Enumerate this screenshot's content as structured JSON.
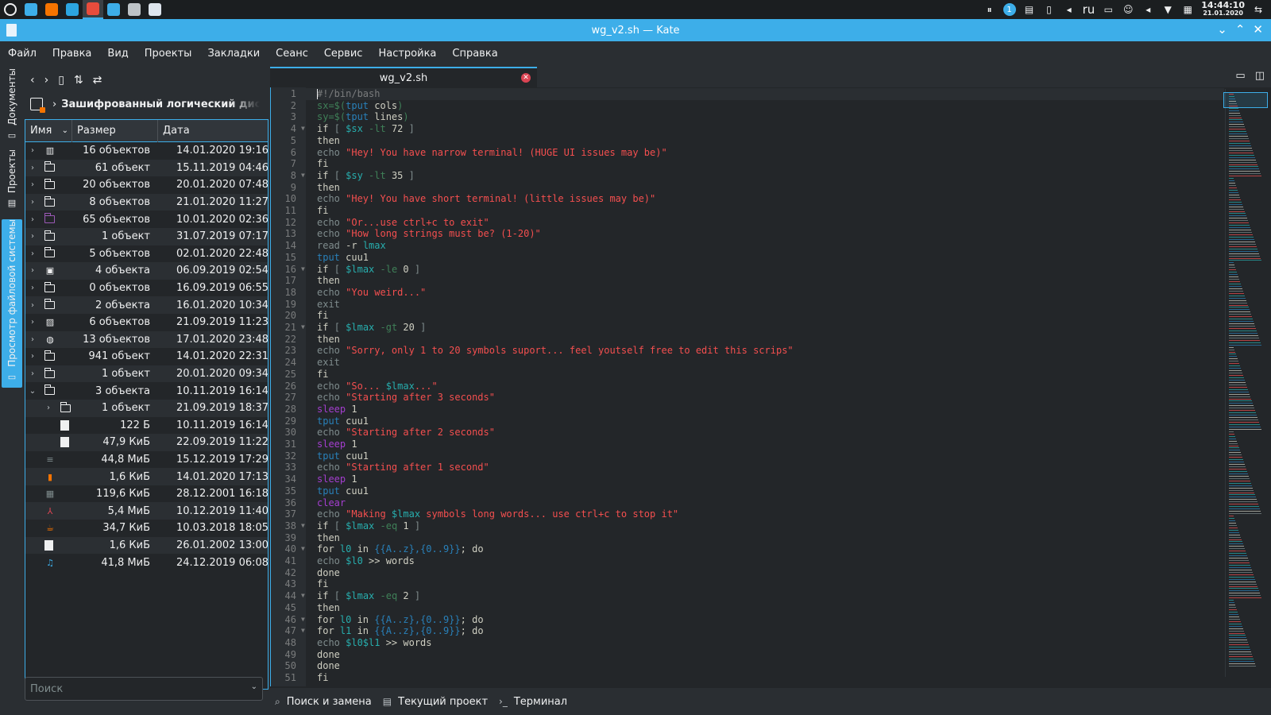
{
  "taskbar": {
    "apps": [
      {
        "name": "launcher-icon",
        "color": "#eff0f1"
      },
      {
        "name": "files-icon",
        "color": "#3daee9"
      },
      {
        "name": "firefox-icon",
        "color": "#f67400"
      },
      {
        "name": "telegram-icon",
        "color": "#2ca5e0"
      },
      {
        "name": "chrome-icon",
        "color": "#e74c3c"
      },
      {
        "name": "kdeconnect-icon",
        "color": "#3daee9"
      },
      {
        "name": "x-app-icon",
        "color": "#bdc3c7"
      },
      {
        "name": "kate-icon",
        "color": "#dfe6ee"
      }
    ],
    "tray": {
      "keyboard_layout": "ru",
      "clock_time": "14:44:10",
      "clock_date": "21.01.2020",
      "badge_count": "1"
    }
  },
  "window": {
    "title": "wg_v2.sh — Kate"
  },
  "menu": [
    "Файл",
    "Правка",
    "Вид",
    "Проекты",
    "Закладки",
    "Сеанс",
    "Сервис",
    "Настройка",
    "Справка"
  ],
  "sidetabs": {
    "documents": "Документы",
    "projects": "Проекты",
    "filesystem": "Просмотр файловой системы"
  },
  "filepanel": {
    "breadcrumb": "Зашифрованный логический диск",
    "columns": {
      "name": "Имя",
      "size": "Размер",
      "date": "Дата"
    },
    "rows": [
      {
        "size": "16 объектов",
        "date": "14.01.2020 19:16",
        "icon": "library",
        "depth": 0,
        "expander": "right"
      },
      {
        "size": "61 объект",
        "date": "15.11.2019 04:46",
        "icon": "folder",
        "depth": 0,
        "expander": "right"
      },
      {
        "size": "20 объектов",
        "date": "20.01.2020 07:48",
        "icon": "folder",
        "depth": 0,
        "expander": "right"
      },
      {
        "size": "8 объектов",
        "date": "21.01.2020 11:27",
        "icon": "folder",
        "depth": 0,
        "expander": "right"
      },
      {
        "size": "65 объектов",
        "date": "10.01.2020 02:36",
        "icon": "folder-purple",
        "depth": 0,
        "expander": "right"
      },
      {
        "size": "1 объект",
        "date": "31.07.2019 07:17",
        "icon": "folder",
        "depth": 0,
        "expander": "right"
      },
      {
        "size": "5 объектов",
        "date": "02.01.2020 22:48",
        "icon": "folder",
        "depth": 0,
        "expander": "right"
      },
      {
        "size": "4 объекта",
        "date": "06.09.2019 02:54",
        "icon": "documents",
        "depth": 0,
        "expander": "right"
      },
      {
        "size": "0 объектов",
        "date": "16.09.2019 06:55",
        "icon": "folder",
        "depth": 0,
        "expander": "right"
      },
      {
        "size": "2 объекта",
        "date": "16.01.2020 10:34",
        "icon": "folder",
        "depth": 0,
        "expander": "right"
      },
      {
        "size": "6 объектов",
        "date": "21.09.2019 11:23",
        "icon": "pictures",
        "depth": 0,
        "expander": "right"
      },
      {
        "size": "13 объектов",
        "date": "17.01.2020 23:48",
        "icon": "public",
        "depth": 0,
        "expander": "right"
      },
      {
        "size": "941 объект",
        "date": "14.01.2020 22:31",
        "icon": "folder",
        "depth": 0,
        "expander": "right"
      },
      {
        "size": "1 объект",
        "date": "20.01.2020 09:34",
        "icon": "folder",
        "depth": 0,
        "expander": "right"
      },
      {
        "size": "3 объекта",
        "date": "10.11.2019 16:14",
        "icon": "folder",
        "depth": 0,
        "expander": "down"
      },
      {
        "size": "1 объект",
        "date": "21.09.2019 18:37",
        "icon": "folder",
        "depth": 1,
        "expander": "right"
      },
      {
        "size": "122 Б",
        "date": "10.11.2019 16:14",
        "icon": "file",
        "depth": 1,
        "expander": "none"
      },
      {
        "size": "47,9 КиБ",
        "date": "22.09.2019 11:22",
        "icon": "file",
        "depth": 1,
        "expander": "none"
      },
      {
        "size": "44,8 МиБ",
        "date": "15.12.2019 17:29",
        "icon": "archive",
        "depth": 0,
        "expander": "none"
      },
      {
        "size": "1,6 КиБ",
        "date": "14.01.2020 17:13",
        "icon": "locked-file",
        "depth": 0,
        "expander": "none"
      },
      {
        "size": "119,6 КиБ",
        "date": "28.12.2001 16:18",
        "icon": "spreadsheet",
        "depth": 0,
        "expander": "none"
      },
      {
        "size": "5,4 МиБ",
        "date": "10.12.2019 11:40",
        "icon": "pdf",
        "depth": 0,
        "expander": "none"
      },
      {
        "size": "34,7 КиБ",
        "date": "10.03.2018 18:05",
        "icon": "java",
        "depth": 0,
        "expander": "none"
      },
      {
        "size": "1,6 КиБ",
        "date": "26.01.2002 13:00",
        "icon": "blank-file",
        "depth": 0,
        "expander": "none"
      },
      {
        "size": "41,8 МиБ",
        "date": "24.12.2019 06:08",
        "icon": "audio",
        "depth": 0,
        "expander": "none"
      }
    ],
    "search_placeholder": "Поиск"
  },
  "editor": {
    "tab_title": "wg_v2.sh",
    "lines": [
      [
        [
          "cm",
          "#!/bin/bash"
        ]
      ],
      [
        [
          "op",
          "sx=$("
        ],
        [
          "cmd",
          "tput"
        ],
        [
          "pl",
          " cols"
        ],
        [
          "op",
          ")"
        ]
      ],
      [
        [
          "op",
          "sy=$("
        ],
        [
          "cmd",
          "tput"
        ],
        [
          "pl",
          " lines"
        ],
        [
          "op",
          ")"
        ]
      ],
      [
        [
          "pl",
          "if "
        ],
        [
          "bi",
          "[ "
        ],
        [
          "var",
          "$sx"
        ],
        [
          "op",
          " -lt"
        ],
        [
          "pl",
          " 72 "
        ],
        [
          "bi",
          "]"
        ]
      ],
      [
        [
          "pl",
          "then"
        ]
      ],
      [
        [
          "bi",
          "echo "
        ],
        [
          "str",
          "\"Hey! You have narrow terminal! (HUGE UI issues may be)\""
        ]
      ],
      [
        [
          "pl",
          "fi"
        ]
      ],
      [
        [
          "pl",
          "if "
        ],
        [
          "bi",
          "[ "
        ],
        [
          "var",
          "$sy"
        ],
        [
          "op",
          " -lt"
        ],
        [
          "pl",
          " 35 "
        ],
        [
          "bi",
          "]"
        ]
      ],
      [
        [
          "pl",
          "then"
        ]
      ],
      [
        [
          "bi",
          "echo "
        ],
        [
          "str",
          "\"Hey! You have short terminal! (little issues may be)\""
        ]
      ],
      [
        [
          "pl",
          "fi"
        ]
      ],
      [
        [
          "bi",
          "echo "
        ],
        [
          "str",
          "\"Or...use ctrl+c to exit\""
        ]
      ],
      [
        [
          "bi",
          "echo "
        ],
        [
          "str",
          "\"How long strings must be? (1-20)\""
        ]
      ],
      [
        [
          "bi",
          "read "
        ],
        [
          "pl",
          "-r "
        ],
        [
          "var",
          "lmax"
        ]
      ],
      [
        [
          "cmd",
          "tput"
        ],
        [
          "pl",
          " cuu1"
        ]
      ],
      [
        [
          "pl",
          "if "
        ],
        [
          "bi",
          "[ "
        ],
        [
          "var",
          "$lmax"
        ],
        [
          "op",
          " -le"
        ],
        [
          "pl",
          " 0 "
        ],
        [
          "bi",
          "]"
        ]
      ],
      [
        [
          "pl",
          "then"
        ]
      ],
      [
        [
          "bi",
          "echo "
        ],
        [
          "str",
          "\"You weird...\""
        ]
      ],
      [
        [
          "bi",
          "exit"
        ]
      ],
      [
        [
          "pl",
          "fi"
        ]
      ],
      [
        [
          "pl",
          "if "
        ],
        [
          "bi",
          "[ "
        ],
        [
          "var",
          "$lmax"
        ],
        [
          "op",
          " -gt"
        ],
        [
          "pl",
          " 20 "
        ],
        [
          "bi",
          "]"
        ]
      ],
      [
        [
          "pl",
          "then"
        ]
      ],
      [
        [
          "bi",
          "echo "
        ],
        [
          "str",
          "\"Sorry, only 1 to 20 symbols suport... feel youtself free to edit this scrips\""
        ]
      ],
      [
        [
          "bi",
          "exit"
        ]
      ],
      [
        [
          "pl",
          "fi"
        ]
      ],
      [
        [
          "bi",
          "echo "
        ],
        [
          "str",
          "\"So... "
        ],
        [
          "var",
          "$lmax"
        ],
        [
          "str",
          "...\""
        ]
      ],
      [
        [
          "bi",
          "echo "
        ],
        [
          "str",
          "\"Starting after 3 seconds\""
        ]
      ],
      [
        [
          "purple",
          "sleep"
        ],
        [
          "pl",
          " 1"
        ]
      ],
      [
        [
          "cmd",
          "tput"
        ],
        [
          "pl",
          " cuu1"
        ]
      ],
      [
        [
          "bi",
          "echo "
        ],
        [
          "str",
          "\"Starting after 2 seconds\""
        ]
      ],
      [
        [
          "purple",
          "sleep"
        ],
        [
          "pl",
          " 1"
        ]
      ],
      [
        [
          "cmd",
          "tput"
        ],
        [
          "pl",
          " cuu1"
        ]
      ],
      [
        [
          "bi",
          "echo "
        ],
        [
          "str",
          "\"Starting after 1 second\""
        ]
      ],
      [
        [
          "purple",
          "sleep"
        ],
        [
          "pl",
          " 1"
        ]
      ],
      [
        [
          "cmd",
          "tput"
        ],
        [
          "pl",
          " cuu1"
        ]
      ],
      [
        [
          "purple",
          "clear"
        ]
      ],
      [
        [
          "bi",
          "echo "
        ],
        [
          "str",
          "\"Making "
        ],
        [
          "var",
          "$lmax"
        ],
        [
          "str",
          " symbols long words... use ctrl+c to stop it\""
        ]
      ],
      [
        [
          "pl",
          "if "
        ],
        [
          "bi",
          "[ "
        ],
        [
          "var",
          "$lmax"
        ],
        [
          "op",
          " -eq"
        ],
        [
          "pl",
          " 1 "
        ],
        [
          "bi",
          "]"
        ]
      ],
      [
        [
          "pl",
          "then"
        ]
      ],
      [
        [
          "pl",
          "for "
        ],
        [
          "var",
          "l0"
        ],
        [
          "pl",
          " in "
        ],
        [
          "cyan",
          "{{A..z},{0..9}}"
        ],
        [
          "pl",
          "; do"
        ]
      ],
      [
        [
          "bi",
          "echo "
        ],
        [
          "var",
          "$l0"
        ],
        [
          "pl",
          " >> words"
        ]
      ],
      [
        [
          "pl",
          "done"
        ]
      ],
      [
        [
          "pl",
          "fi"
        ]
      ],
      [
        [
          "pl",
          "if "
        ],
        [
          "bi",
          "[ "
        ],
        [
          "var",
          "$lmax"
        ],
        [
          "op",
          " -eq"
        ],
        [
          "pl",
          " 2 "
        ],
        [
          "bi",
          "]"
        ]
      ],
      [
        [
          "pl",
          "then"
        ]
      ],
      [
        [
          "pl",
          "for "
        ],
        [
          "var",
          "l0"
        ],
        [
          "pl",
          " in "
        ],
        [
          "cyan",
          "{{A..z},{0..9}}"
        ],
        [
          "pl",
          "; do"
        ]
      ],
      [
        [
          "pl",
          "for "
        ],
        [
          "var",
          "l1"
        ],
        [
          "pl",
          " in "
        ],
        [
          "cyan",
          "{{A..z},{0..9}}"
        ],
        [
          "pl",
          "; do"
        ]
      ],
      [
        [
          "bi",
          "echo "
        ],
        [
          "var",
          "$l0$l1"
        ],
        [
          "pl",
          " >> words"
        ]
      ],
      [
        [
          "pl",
          "done"
        ]
      ],
      [
        [
          "pl",
          "done"
        ]
      ],
      [
        [
          "pl",
          "fi"
        ]
      ]
    ],
    "fold_lines": [
      4,
      8,
      16,
      21,
      38,
      40,
      44,
      46,
      47
    ]
  },
  "bottom_tools": [
    {
      "icon": "search-icon",
      "label": "Поиск и замена"
    },
    {
      "icon": "project-icon",
      "label": "Текущий проект"
    },
    {
      "icon": "terminal-icon",
      "label": "Терминал"
    }
  ],
  "colors": {
    "accent": "#3daee9",
    "background": "#232629",
    "panel": "#2a2e32",
    "string": "#f44f4f",
    "variable": "#27aeae",
    "close_button": "#da4453"
  }
}
